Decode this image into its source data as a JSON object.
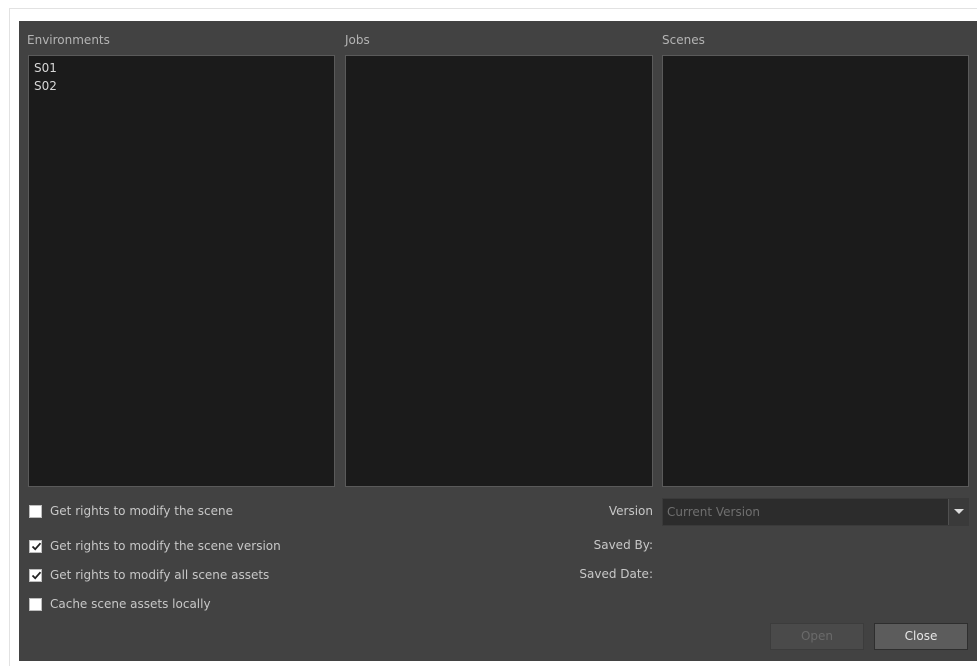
{
  "columns": {
    "environments": {
      "label": "Environments",
      "items": [
        "S01",
        "S02"
      ]
    },
    "jobs": {
      "label": "Jobs",
      "items": []
    },
    "scenes": {
      "label": "Scenes",
      "items": []
    }
  },
  "options": [
    {
      "label": "Get rights to modify the scene",
      "checked": false
    },
    {
      "label": "Get rights to modify the scene version",
      "checked": true
    },
    {
      "label": "Get rights to modify all scene assets",
      "checked": true
    },
    {
      "label": "Cache scene assets locally",
      "checked": false
    }
  ],
  "version": {
    "label": "Version",
    "value": "Current Version"
  },
  "saved_by": {
    "label": "Saved By:"
  },
  "saved_date": {
    "label": "Saved Date:"
  },
  "buttons": {
    "open": "Open",
    "close": "Close"
  },
  "colors": {
    "dialog_bg": "#424242",
    "panel_bg": "#1b1b1b",
    "text": "#c8c8c8",
    "disabled_text": "#6a6a6a"
  }
}
